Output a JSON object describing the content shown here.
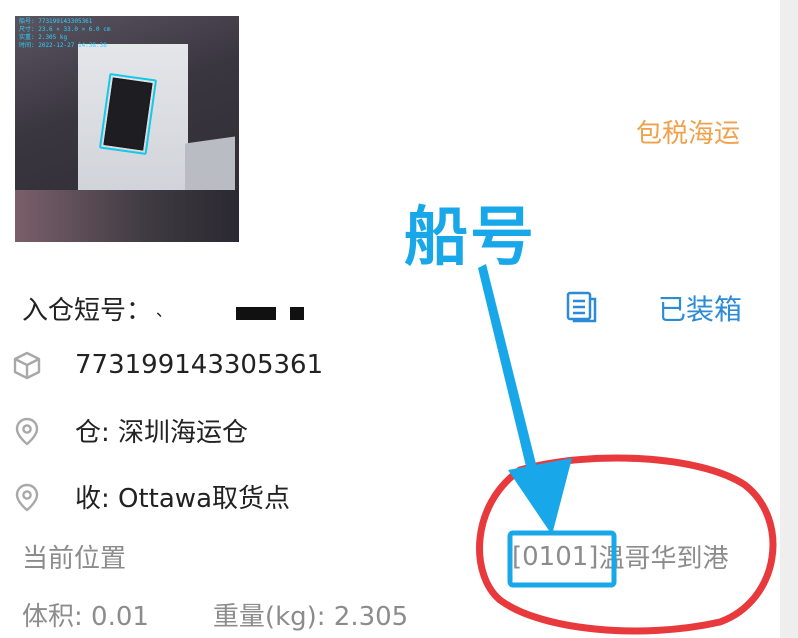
{
  "photo": {
    "overlay_lines": [
      "船号: 773199143305361",
      "尺寸: 23.6 × 33.0 × 6.0 cm",
      "实重: 2.305 kg",
      "时间: 2022-12-27 14:38:38"
    ]
  },
  "header": {
    "shipping_type": "包税海运"
  },
  "annotation": {
    "label": "船号"
  },
  "parcel": {
    "short_code_label": "入仓短号：",
    "short_code_value": "、",
    "status": "已装箱",
    "tracking_number": "773199143305361",
    "warehouse": "仓: 深圳海运仓",
    "receiver": "收: Ottawa取货点",
    "current_location_label": "当前位置",
    "current_location_code": "[0101]",
    "current_location_name": "温哥华到港",
    "volume": "体积: 0.01",
    "weight": "重量(kg): 2.305"
  },
  "colors": {
    "accent_orange": "#f0a14b",
    "link_blue": "#2b8bd6",
    "annotation_blue": "#18a7e8",
    "annotation_red": "#e8393d"
  },
  "icons": {
    "box": "box-icon",
    "location": "location-pin-icon",
    "document": "document-icon"
  }
}
